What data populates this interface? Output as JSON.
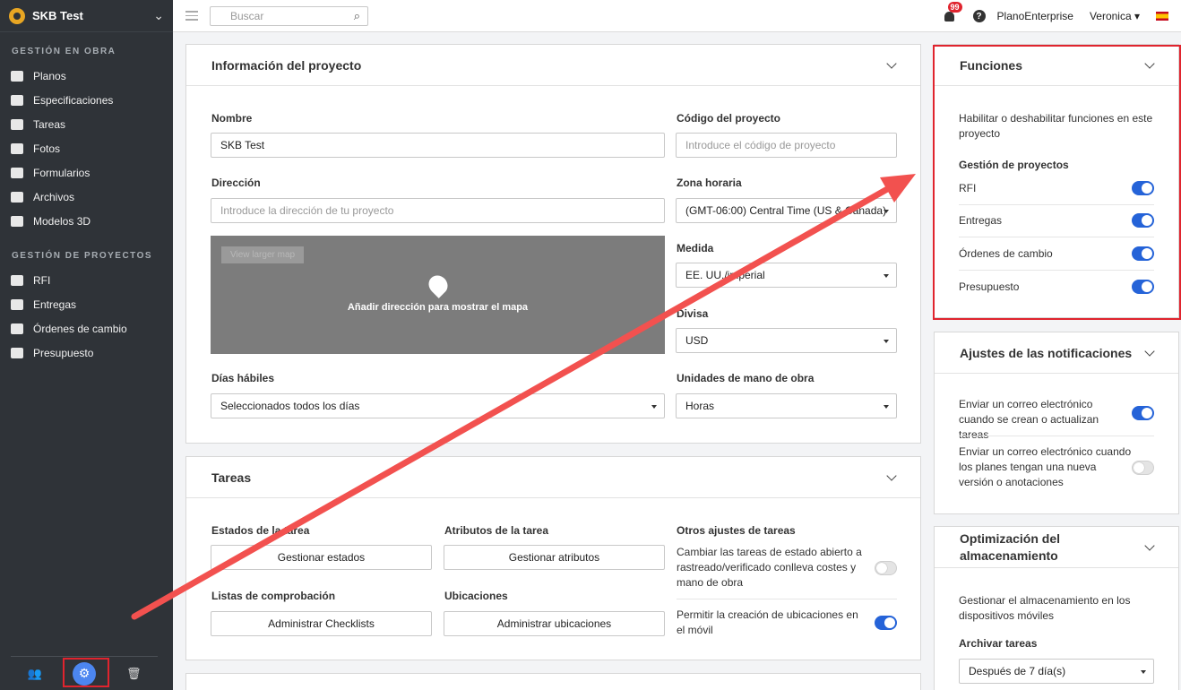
{
  "sidebar": {
    "project_name": "SKB Test",
    "section_obra": "GESTIÓN EN OBRA",
    "obra_items": [
      {
        "label": "Planos"
      },
      {
        "label": "Especificaciones"
      },
      {
        "label": "Tareas"
      },
      {
        "label": "Fotos"
      },
      {
        "label": "Formularios"
      },
      {
        "label": "Archivos"
      },
      {
        "label": "Modelos 3D"
      }
    ],
    "section_proyectos": "GESTIÓN DE PROYECTOS",
    "proyecto_items": [
      {
        "label": "RFI"
      },
      {
        "label": "Entregas"
      },
      {
        "label": "Órdenes de cambio"
      },
      {
        "label": "Presupuesto"
      }
    ]
  },
  "topbar": {
    "search_placeholder": "Buscar",
    "notifications_count": "99",
    "plan": "PlanoEnterprise",
    "user": "Veronica"
  },
  "info": {
    "title": "Información del proyecto",
    "name_label": "Nombre",
    "name_value": "SKB Test",
    "code_label": "Código del proyecto",
    "code_placeholder": "Introduce el código de proyecto",
    "address_label": "Dirección",
    "address_placeholder": "Introduce la dirección de tu proyecto",
    "timezone_label": "Zona horaria",
    "timezone_value": "(GMT-06:00) Central Time (US & Canada)",
    "map_text": "Añadir dirección para mostrar el mapa",
    "map_button": "View larger map",
    "measure_label": "Medida",
    "measure_value": "EE. UU./imperial",
    "currency_label": "Divisa",
    "currency_value": "USD",
    "days_label": "Días hábiles",
    "days_value": "Seleccionados todos los días",
    "labor_label": "Unidades de mano de obra",
    "labor_value": "Horas"
  },
  "tasks": {
    "title": "Tareas",
    "states_label": "Estados de la tarea",
    "states_button": "Gestionar estados",
    "attrs_label": "Atributos de la tarea",
    "attrs_button": "Gestionar atributos",
    "other_label": "Otros ajustes de tareas",
    "change_text": "Cambiar las tareas de estado abierto a rastreado/verificado conlleva costes y mano de obra",
    "checklists_label": "Listas de comprobación",
    "checklists_button": "Administrar Checklists",
    "locations_label": "Ubicaciones",
    "locations_button": "Administrar ubicaciones",
    "mobile_text": "Permitir la creación de ubicaciones en el móvil"
  },
  "functions": {
    "title": "Funciones",
    "desc": "Habilitar o deshabilitar funciones en este proyecto",
    "subtitle": "Gestión de proyectos",
    "items": [
      {
        "label": "RFI",
        "enabled": true
      },
      {
        "label": "Entregas",
        "enabled": true
      },
      {
        "label": "Órdenes de cambio",
        "enabled": true
      },
      {
        "label": "Presupuesto",
        "enabled": true
      }
    ]
  },
  "notifications": {
    "title": "Ajustes de las notificaciones",
    "email_tasks": "Enviar un correo electrónico cuando se crean o actualizan tareas",
    "email_plans": "Enviar un correo electrónico cuando los planes tengan una nueva versión o anotaciones"
  },
  "storage": {
    "title": "Optimización del almacenamiento",
    "desc": "Gestionar el almacenamiento en los dispositivos móviles",
    "archive_label": "Archivar tareas",
    "archive_value": "Después de 7 día(s)"
  },
  "colors": {
    "accent": "#2563d8",
    "highlight": "#e0242e",
    "arrow": "#f2514f"
  }
}
